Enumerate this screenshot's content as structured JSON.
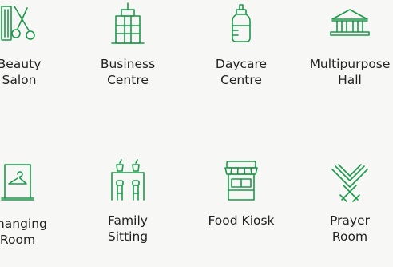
{
  "accent_color": "#1a9a4a",
  "amenities": [
    {
      "label": "Beauty\nSalon",
      "icon": "scissors-comb-icon"
    },
    {
      "label": "Business\nCentre",
      "icon": "office-building-icon"
    },
    {
      "label": "Daycare\nCentre",
      "icon": "baby-bottle-icon"
    },
    {
      "label": "Multipurpose\nHall",
      "icon": "hall-building-icon"
    },
    {
      "label": "Changing\nRoom",
      "icon": "hanger-icon"
    },
    {
      "label": "Family\nSitting",
      "icon": "bar-stools-icon"
    },
    {
      "label": "Food Kiosk",
      "icon": "kiosk-icon"
    },
    {
      "label": "Prayer\nRoom",
      "icon": "quran-stand-icon"
    }
  ]
}
